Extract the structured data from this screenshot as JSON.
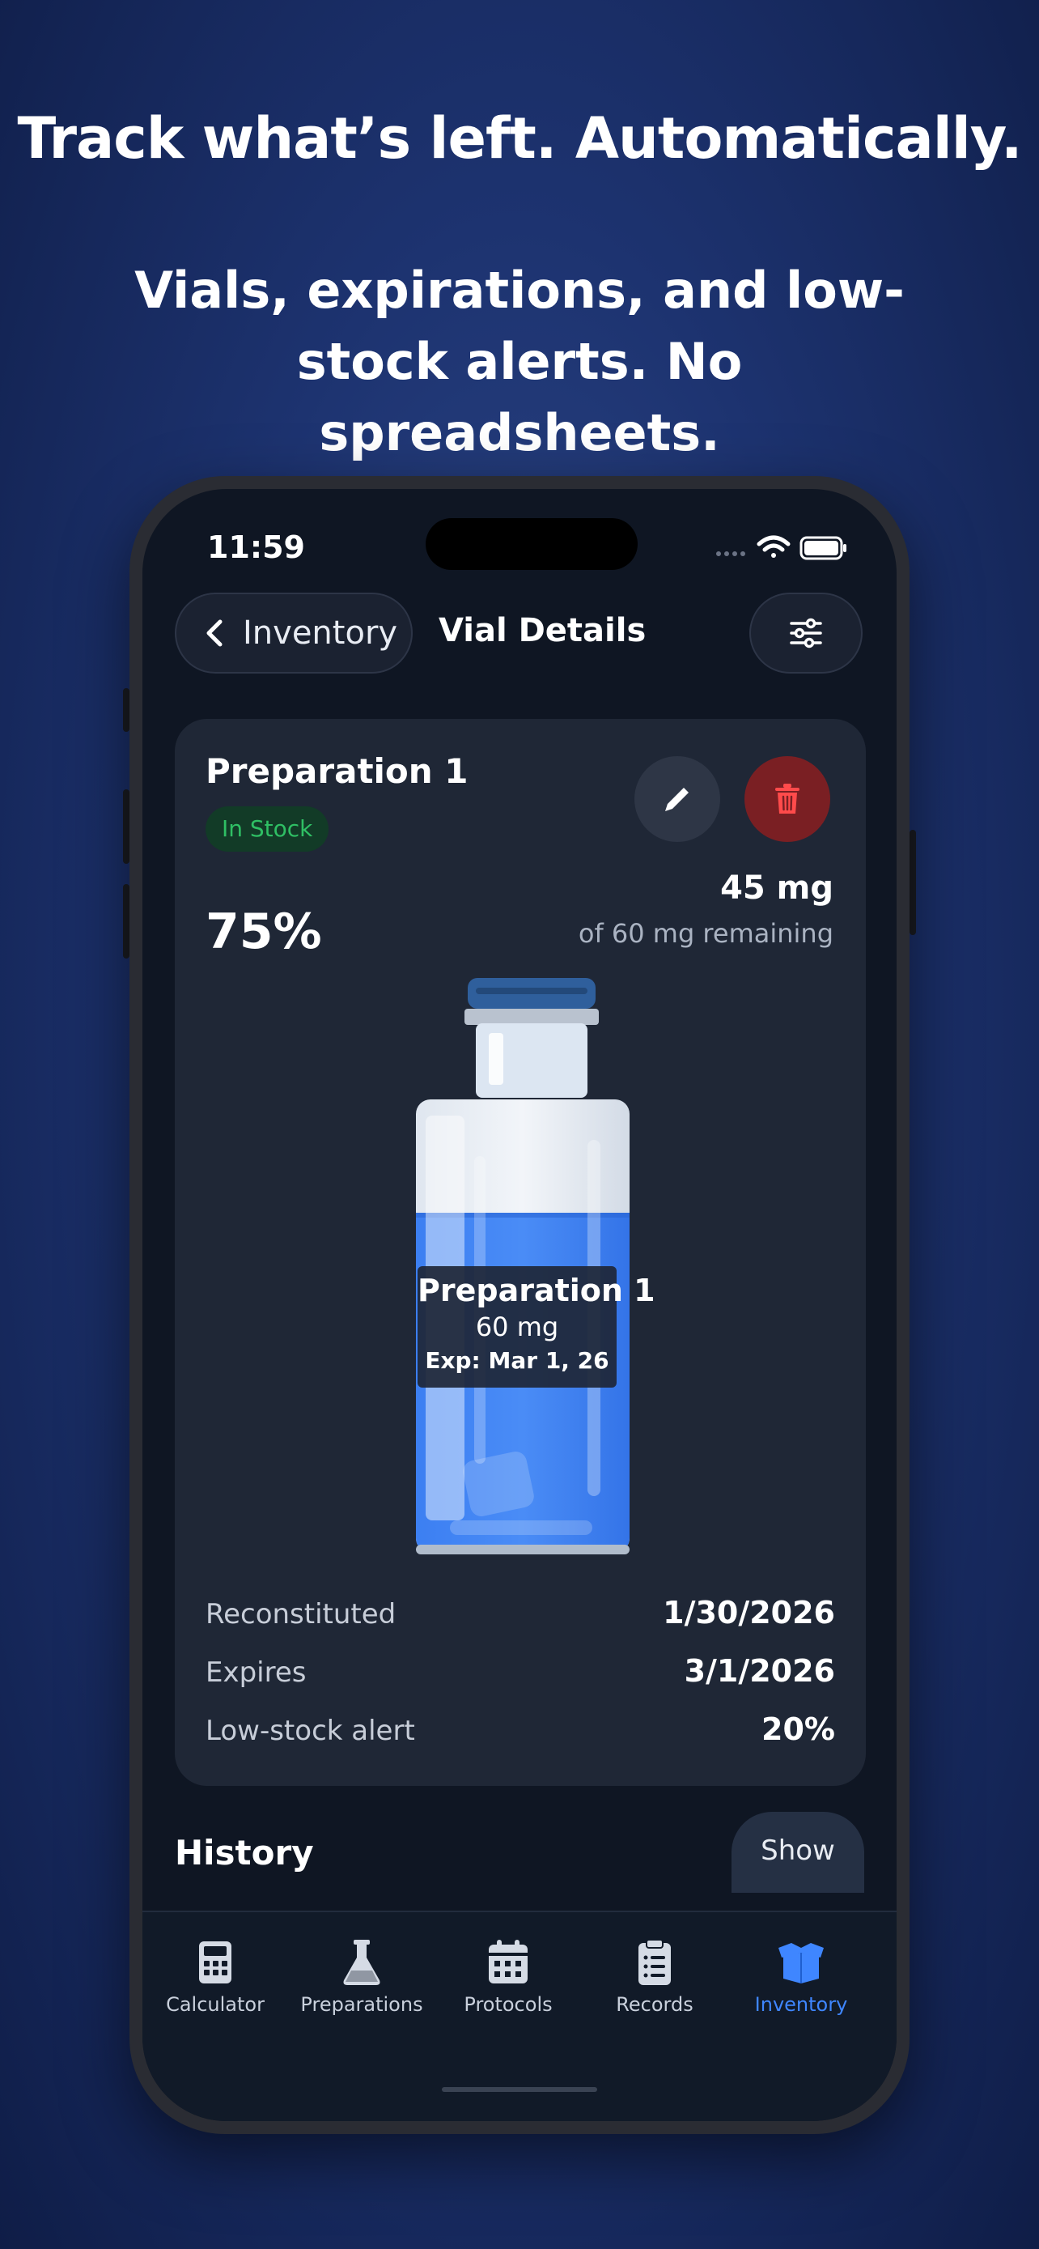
{
  "promo": {
    "headline": "Track what’s left. Automatically.",
    "subline": "Vials, expirations, and low-stock alerts. No spreadsheets."
  },
  "status": {
    "time": "11:59"
  },
  "nav": {
    "back_label": "Inventory",
    "title": "Vial Details"
  },
  "vial": {
    "name": "Preparation 1",
    "status": "In Stock",
    "percent_text": "75%",
    "remaining_amount": "45 mg",
    "remaining_text": "of 60 mg remaining",
    "fill_fraction": 0.75,
    "label_name": "Preparation 1",
    "label_amount": "60 mg",
    "label_exp": "Exp: Mar 1, 26",
    "details": [
      {
        "key": "Reconstituted",
        "value": "1/30/2026"
      },
      {
        "key": "Expires",
        "value": "3/1/2026"
      },
      {
        "key": "Low-stock alert",
        "value": "20%"
      }
    ]
  },
  "history": {
    "title": "History",
    "show_label": "Show"
  },
  "tabs": [
    {
      "label": "Calculator",
      "icon": "calculator-icon"
    },
    {
      "label": "Preparations",
      "icon": "flask-icon"
    },
    {
      "label": "Protocols",
      "icon": "calendar-icon"
    },
    {
      "label": "Records",
      "icon": "clipboard-icon"
    },
    {
      "label": "Inventory",
      "icon": "box-icon",
      "active": true
    }
  ],
  "colors": {
    "accent": "#3f86ff",
    "stock_green": "#2fbf64",
    "delete_red": "#7a1f23",
    "liquid_blue": "#3a7ff0"
  }
}
